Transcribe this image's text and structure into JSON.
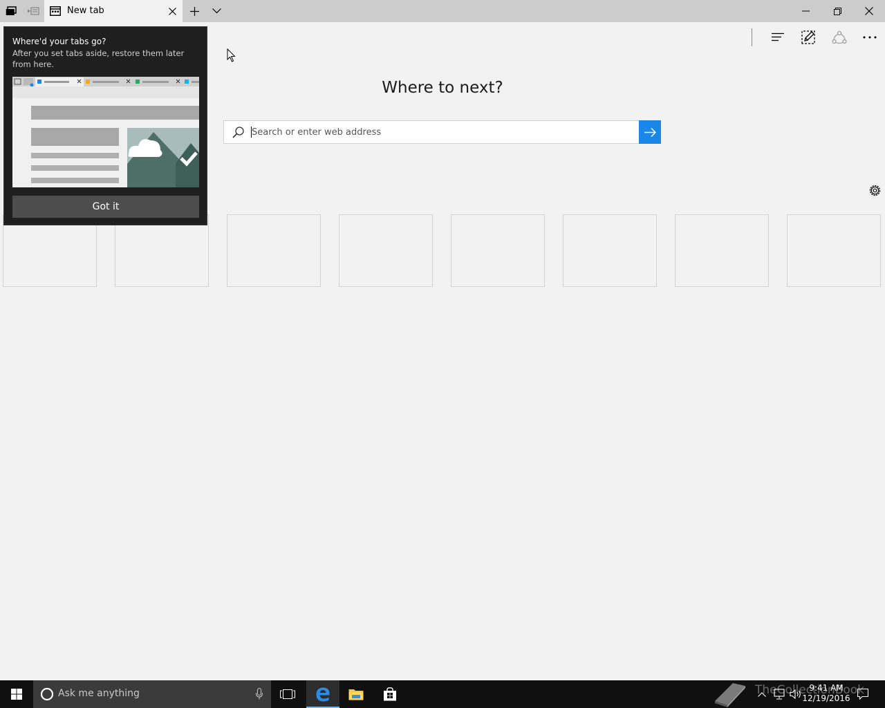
{
  "tab": {
    "title": "New tab"
  },
  "popup": {
    "title": "Where'd your tabs go?",
    "description": "After you set tabs aside, restore them later from here.",
    "button_label": "Got it"
  },
  "page": {
    "heading": "Where to next?",
    "search_placeholder": "Search or enter web address",
    "top_sites_count": 8
  },
  "taskbar": {
    "cortana_placeholder": "Ask me anything",
    "watermark": "TheCollectionBook",
    "clock_time": "9:41 AM",
    "clock_date": "12/19/2016"
  },
  "colors": {
    "titlebar": "#cccccc",
    "page_background": "#f2f2f2",
    "accent": "#1a87e8",
    "popup_background": "#1f1f1f",
    "taskbar": "#101010"
  }
}
